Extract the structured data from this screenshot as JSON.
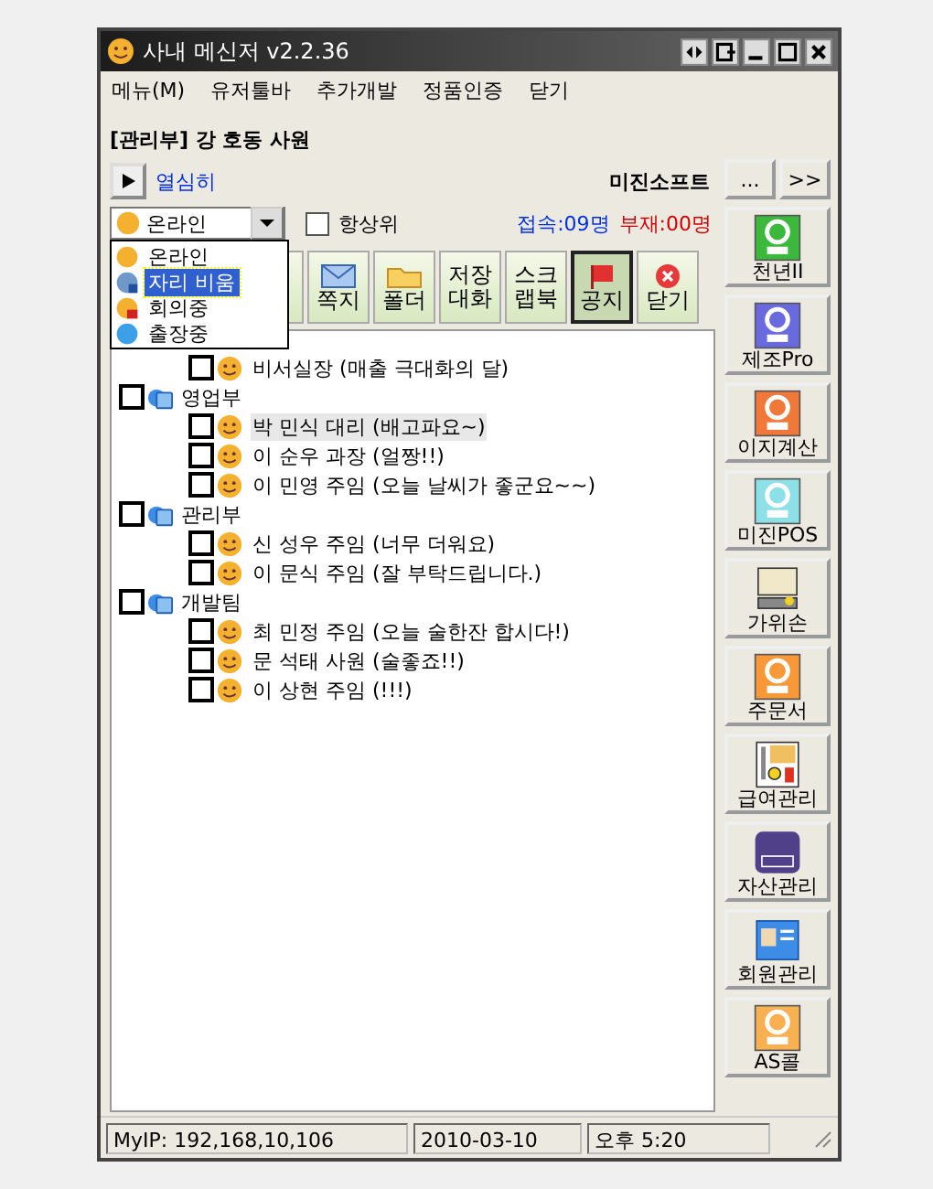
{
  "window": {
    "title": "사내 메신저 v2.2.36"
  },
  "menu": [
    "메뉴(M)",
    "유저툴바",
    "추가개발",
    "정품인증",
    "닫기"
  ],
  "user": {
    "name": "[관리부] 강 호동 사원",
    "mood": "열심히",
    "company": "미진소프트"
  },
  "status": {
    "value": "온라인",
    "always_on_top": false,
    "always_on_top_label": "항상위",
    "connected": "접속:09명",
    "away": "부재:00명"
  },
  "status_menu": [
    {
      "label": "온라인",
      "kind": "online",
      "selected": false
    },
    {
      "label": "자리 비움",
      "kind": "away",
      "selected": true
    },
    {
      "label": "회의중",
      "kind": "meeting",
      "selected": false
    },
    {
      "label": "출장중",
      "kind": "trip",
      "selected": false
    }
  ],
  "toolbar": [
    {
      "label": "쪽지",
      "kind": "mail",
      "pressed": false
    },
    {
      "label": "폴더",
      "kind": "folder",
      "pressed": false
    },
    {
      "label": "저장\n대화",
      "kind": "text",
      "pressed": false
    },
    {
      "label": "스크\n랩북",
      "kind": "text",
      "pressed": false
    },
    {
      "label": "공지",
      "kind": "flag",
      "pressed": true
    },
    {
      "label": "닫기",
      "kind": "close",
      "pressed": false
    }
  ],
  "tree": [
    {
      "children": [
        {
          "label": "비서실장 (매출 극대화의 달)",
          "checked": false,
          "selected": false
        }
      ]
    },
    {
      "label": "영업부",
      "checked": false,
      "children": [
        {
          "label": "박 민식 대리 (배고파요~)",
          "checked": false,
          "selected": true
        },
        {
          "label": "이 순우 과장 (얼짱!!)",
          "checked": false,
          "selected": false
        },
        {
          "label": "이 민영 주임 (오늘 날씨가 좋군요~~)",
          "checked": false,
          "selected": false
        }
      ]
    },
    {
      "label": "관리부",
      "checked": false,
      "children": [
        {
          "label": "신 성우 주임 (너무 더워요)",
          "checked": false,
          "selected": false
        },
        {
          "label": "이 문식 주임 (잘 부탁드립니다.)",
          "checked": false,
          "selected": false
        }
      ]
    },
    {
      "label": "개발팀",
      "checked": false,
      "children": [
        {
          "label": "최 민정 주임 (오늘 술한잔 합시다!)",
          "checked": false,
          "selected": false
        },
        {
          "label": "문 석태 사원 (술좋죠!!)",
          "checked": false,
          "selected": false
        },
        {
          "label": "이 상현 주임 (!!!)",
          "checked": false,
          "selected": false
        }
      ]
    }
  ],
  "side_top": [
    "...",
    ">>"
  ],
  "sidebar": [
    {
      "label": "천년II",
      "kind": "tile",
      "color": "#3cb83c"
    },
    {
      "label": "제조Pro",
      "kind": "tile",
      "color": "#6a6ae0"
    },
    {
      "label": "이지계산",
      "kind": "tile",
      "color": "#f07838"
    },
    {
      "label": "미진POS",
      "kind": "tile",
      "color": "#8ee0e8"
    },
    {
      "label": "가위손",
      "kind": "computer",
      "color": "#f0e8c8"
    },
    {
      "label": "주문서",
      "kind": "tile",
      "color": "#f89838"
    },
    {
      "label": "급여관리",
      "kind": "ledger",
      "color": "#f0c060"
    },
    {
      "label": "자산관리",
      "kind": "badge",
      "color": "#50408a"
    },
    {
      "label": "회원관리",
      "kind": "card",
      "color": "#3c8ce8"
    },
    {
      "label": "AS콜",
      "kind": "tile",
      "color": "#f8b050"
    }
  ],
  "status_bar": [
    "MyIP: 192,168,10,106",
    "2010-03-10",
    "오후 5:20"
  ]
}
